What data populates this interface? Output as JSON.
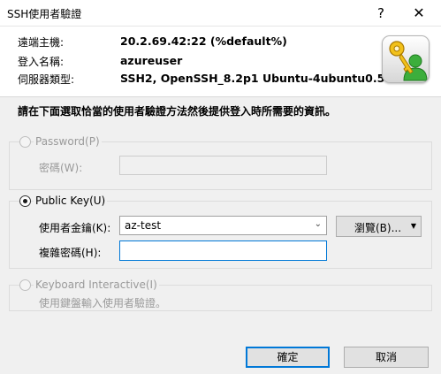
{
  "window": {
    "title": "SSH使用者驗證",
    "help_glyph": "?",
    "close_glyph": "✕"
  },
  "connection": {
    "remote_host_label": "遠端主機:",
    "remote_host_value": "20.2.69.42:22 (%default%)",
    "login_name_label": "登入名稱:",
    "login_name_value": "azureuser",
    "server_type_label": "伺服器類型:",
    "server_type_value": "SSH2, OpenSSH_8.2p1 Ubuntu-4ubuntu0.5"
  },
  "instruction": "請在下面選取恰當的使用者驗證方法然後提供登入時所需要的資訊。",
  "password_method": {
    "label": "Password(P)",
    "selected": false,
    "enabled": false,
    "password_label": "密碼(W):",
    "password_value": ""
  },
  "publickey_method": {
    "label": "Public Key(U)",
    "selected": true,
    "enabled": true,
    "user_key_label": "使用者金鑰(K):",
    "user_key_value": "az-test",
    "browse_label": "瀏覽(B)...",
    "passphrase_label": "複雜密碼(H):",
    "passphrase_value": ""
  },
  "keyboard_method": {
    "label": "Keyboard Interactive(I)",
    "selected": false,
    "enabled": false,
    "description": "使用鍵盤輸入使用者驗證。"
  },
  "buttons": {
    "ok_label": "確定",
    "cancel_label": "取消"
  },
  "icons": {
    "app_icon": "user-key-icon"
  },
  "colors": {
    "focus_blue": "#0078d7",
    "key_gold": "#e0a400",
    "user_green": "#2e9e2e"
  }
}
